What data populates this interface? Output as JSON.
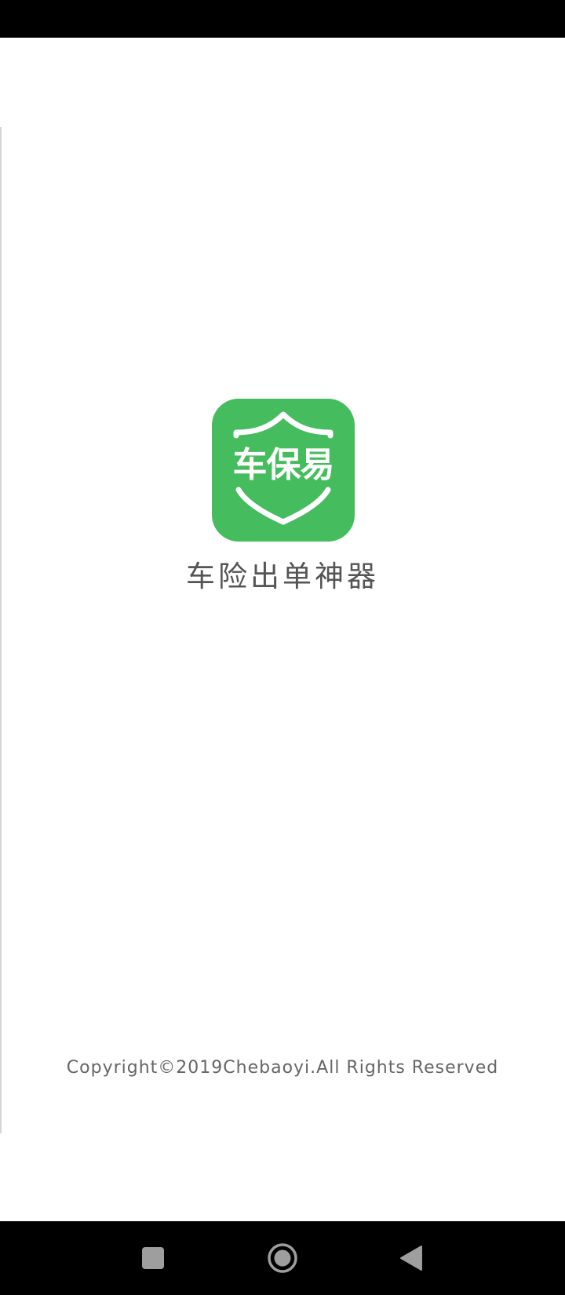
{
  "app": {
    "logo_text": "车保易",
    "tagline": "车险出单神器",
    "copyright": "Copyright©2019Chebaoyi.All Rights Reserved"
  },
  "colors": {
    "brand_green": "#45bc5d",
    "system_bar": "#000000",
    "nav_icon": "#9e9e9e"
  },
  "navigation_bar": {
    "buttons": [
      {
        "icon": "recent-apps-icon"
      },
      {
        "icon": "home-icon"
      },
      {
        "icon": "back-icon"
      }
    ]
  }
}
